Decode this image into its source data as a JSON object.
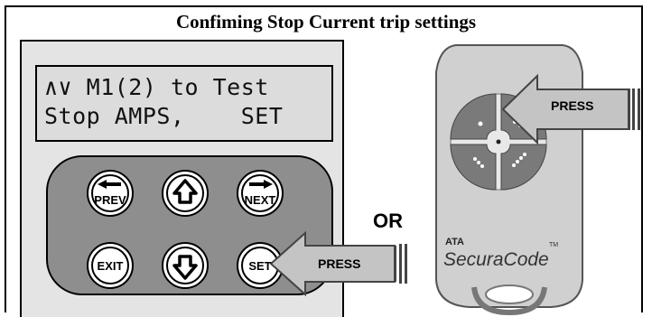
{
  "title": "Confiming Stop Current trip settings",
  "lcd": {
    "line1": "∧∨ M1(2) to Test",
    "line2": "Stop AMPS,    SET"
  },
  "keypad": {
    "prev_label": "PREV",
    "next_label": "NEXT",
    "exit_label": "EXIT",
    "set_label": "SET"
  },
  "remote": {
    "brand_small": "ATA",
    "brand_name": "SecuraCode",
    "trademark": "TM"
  },
  "or_label": "OR",
  "press_label_remote": "PRESS",
  "press_label_keypad": "PRESS",
  "colors": {
    "panel_bg": "#e4e4e4",
    "lcd_bg": "#dcdcdc",
    "keypad_bg": "#8e8e8e",
    "remote_body": "#d0d0d0",
    "remote_buttons": "#7a7a7a",
    "arrow_fill": "#c4c4c4"
  }
}
